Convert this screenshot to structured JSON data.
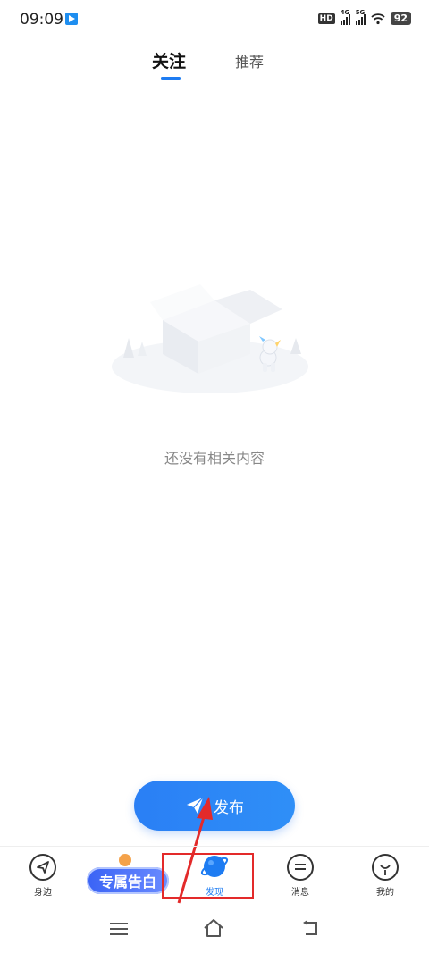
{
  "status_bar": {
    "time": "09:09",
    "hd_label": "HD",
    "signal_1_label": "4G",
    "signal_2_label": "5G",
    "battery": "92"
  },
  "tabs": {
    "follow": "关注",
    "recommend": "推荐",
    "active": "关注",
    "accent_color": "#1e7cf2"
  },
  "empty_state": {
    "message": "还没有相关内容"
  },
  "publish_button": {
    "label": "发布"
  },
  "promo": {
    "label": "专属告白"
  },
  "bottom_nav": {
    "items": [
      {
        "label": "身边",
        "icon": "navigate-icon"
      },
      {
        "label": "发现",
        "icon": "planet-icon"
      },
      {
        "label": "消息",
        "icon": "message-icon"
      },
      {
        "label": "我的",
        "icon": "profile-icon"
      }
    ],
    "active": "发现"
  }
}
